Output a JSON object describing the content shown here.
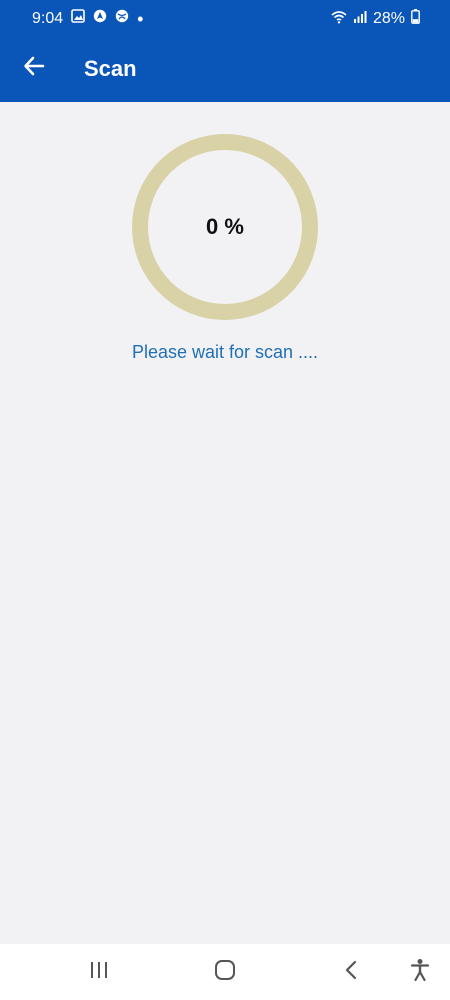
{
  "status_bar": {
    "time": "9:04",
    "battery_percent": "28%",
    "icons": [
      "gallery-icon",
      "navigation-icon",
      "browser-icon",
      "notification-dot-icon",
      "wifi-icon",
      "signal-icon",
      "battery-icon"
    ]
  },
  "appbar": {
    "title": "Scan",
    "back_icon": "arrow-left-icon"
  },
  "scan": {
    "progress_value": 0,
    "progress_text": "0 %",
    "message": "Please wait for scan ...."
  },
  "colors": {
    "appbar_bg": "#0a55b8",
    "page_bg": "#f2f2f5",
    "ring": "#d8d2a6",
    "message": "#1f6fb5"
  },
  "nav_bar": {
    "buttons": [
      "recent-apps-icon",
      "home-icon",
      "back-icon",
      "accessibility-icon"
    ]
  }
}
